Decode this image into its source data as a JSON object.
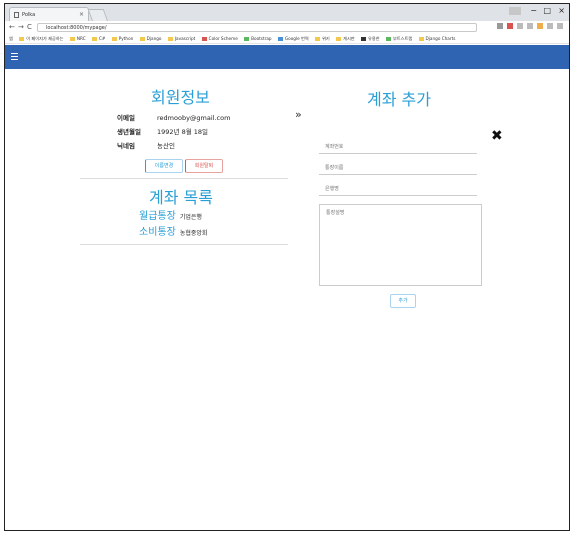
{
  "browser": {
    "tab_title": "Polka",
    "tab_close": "×",
    "url": "localhost:8000/mypage/",
    "nav": {
      "back": "←",
      "forward": "→",
      "reload": "C"
    },
    "window_controls": {
      "minimize": "−",
      "maximize": "□",
      "close": "×"
    },
    "bookmarks": [
      "앱",
      "이 페이지가 제공하는",
      "NRC",
      "C#",
      "Python",
      "Django",
      "Javascript",
      "Color Scheme",
      "Bootstrap",
      "Google 번역",
      "위키",
      "게시판",
      "유용한",
      "부트스트랩",
      "Django Charts"
    ]
  },
  "navbar": {
    "menu_icon": "hamburger-icon"
  },
  "profile": {
    "title": "회원정보",
    "fields": [
      {
        "label": "이메일",
        "value": "redmooby@gmail.com"
      },
      {
        "label": "생년월일",
        "value": "1992년 8월 18일"
      },
      {
        "label": "닉네임",
        "value": "농산인"
      }
    ],
    "edit_button": "이름변경",
    "withdraw_button": "회원탈퇴"
  },
  "accounts": {
    "title": "계좌 목록",
    "items": [
      {
        "name": "월급통장",
        "bank": "기업은행"
      },
      {
        "name": "소비통장",
        "bank": "농협중앙회"
      }
    ]
  },
  "add_account": {
    "title": "계좌 추가",
    "arrow": "»",
    "close": "✖",
    "placeholders": {
      "account_number": "계좌번호",
      "account_name": "통장이름",
      "bank": "은행명",
      "memo": "통장설명"
    },
    "submit": "추가"
  },
  "colors": {
    "accent": "#2a9fd6",
    "navbar": "#2f64b3",
    "danger": "#d9534f"
  }
}
